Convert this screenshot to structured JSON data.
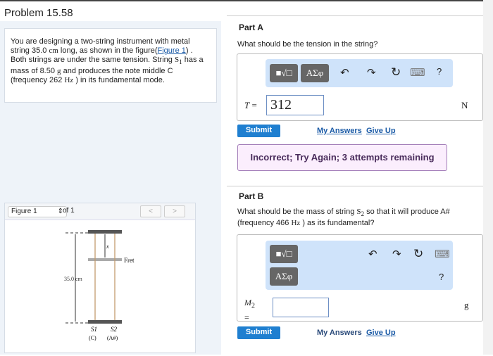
{
  "title": "Problem 15.58",
  "problem": {
    "p1": "You are designing a two-string instrument with metal string 35.0 ",
    "u1": "cm",
    "p2": " long, as shown in the figure(",
    "fig_link": "Figure 1",
    "p3": ") . Both strings are under the same tension. String ",
    "s1": "S",
    "s1sub": "1",
    "p4": " has a mass of 8.50 ",
    "u2": "g",
    "p5": " and produces the note middle C (frequency 262 ",
    "u3": "Hz",
    "p6": " ) in its fundamental mode."
  },
  "figure": {
    "selector": "Figure 1",
    "of": "of 1",
    "prev": "<",
    "next": ">",
    "length_label": "35.0 cm",
    "fret_label": "Fret",
    "x_label": "x",
    "s1": "S1",
    "s2": "S2",
    "s1_note": "(C)",
    "s2_note": "(A#)"
  },
  "partA": {
    "label": "Part A",
    "question": "What should be the tension in the string?",
    "toolbar": {
      "templates": "■√□",
      "greek": "ΑΣφ",
      "undo": "↶",
      "redo": "↷",
      "reset": "↻",
      "keyboard": "⌨",
      "help": "?"
    },
    "var": "T",
    "eq": "=",
    "value": "312",
    "unit": "N",
    "submit": "Submit",
    "my_answers": "My Answers",
    "give_up": "Give Up",
    "feedback": "Incorrect; Try Again; 3 attempts remaining"
  },
  "partB": {
    "label": "Part B",
    "q1": "What should be the mass of string ",
    "s2": "S",
    "s2sub": "2",
    "q2": " so that it will produce A# (frequency 466 ",
    "u": "Hz",
    "q3": " ) as its fundamental?",
    "toolbar": {
      "templates": "■√□",
      "greek": "ΑΣφ",
      "undo": "↶",
      "redo": "↷",
      "reset": "↻",
      "keyboard": "⌨",
      "help": "?"
    },
    "var": "M",
    "varsub": "2",
    "eq": "=",
    "value": "",
    "unit": "g",
    "submit": "Submit",
    "my_answers": "My Answers",
    "give_up": "Give Up"
  }
}
